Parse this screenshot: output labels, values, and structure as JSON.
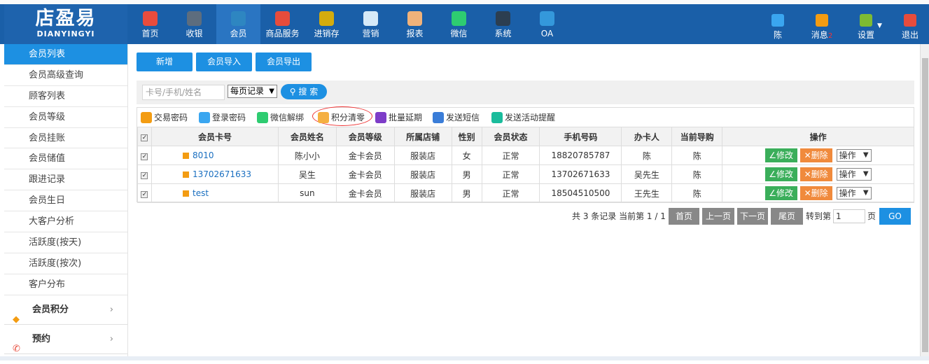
{
  "logo": {
    "cn": "店盈易",
    "en": "DIANYINGYI"
  },
  "nav": [
    {
      "label": "首页",
      "icon": "home-icon",
      "color": "#e84c3d"
    },
    {
      "label": "收银",
      "icon": "cashier-icon",
      "color": "#5d6d7e"
    },
    {
      "label": "会员",
      "icon": "member-icon",
      "color": "#2e86c1"
    },
    {
      "label": "商品服务",
      "icon": "goods-icon",
      "color": "#e74c3c"
    },
    {
      "label": "进销存",
      "icon": "inventory-icon",
      "color": "#d4ac0d"
    },
    {
      "label": "营销",
      "icon": "megaphone-icon",
      "color": "#d6eaf8"
    },
    {
      "label": "报表",
      "icon": "report-icon",
      "color": "#f0b27a"
    },
    {
      "label": "微信",
      "icon": "wechat-icon",
      "color": "#2ecc71"
    },
    {
      "label": "系统",
      "icon": "monitor-icon",
      "color": "#2c3e50"
    },
    {
      "label": "OA",
      "icon": "oa-icon",
      "color": "#3498db"
    }
  ],
  "right_nav": {
    "user": {
      "label": "陈",
      "icon": "user-icon",
      "color": "#3aa6f0"
    },
    "message": {
      "label": "消息",
      "badge": "2",
      "icon": "bell-icon",
      "color": "#f39c12"
    },
    "settings": {
      "label": "设置",
      "icon": "gear-icon",
      "color": "#7dbb33"
    },
    "logout": {
      "label": "退出",
      "icon": "logout-icon",
      "color": "#e74c3c"
    }
  },
  "sidebar": {
    "items": [
      "会员列表",
      "会员高级查询",
      "顾客列表",
      "会员等级",
      "会员挂账",
      "会员储值",
      "跟进记录",
      "会员生日",
      "大客户分析",
      "活跃度(按天)",
      "活跃度(按次)",
      "客户分布"
    ],
    "groups": [
      {
        "label": "会员积分"
      },
      {
        "label": "预约"
      }
    ]
  },
  "actions": {
    "add": "新增",
    "import": "会员导入",
    "export": "会员导出"
  },
  "search": {
    "placeholder": "卡号/手机/姓名",
    "page_size": "每页记录",
    "button": "搜 索"
  },
  "tools": [
    {
      "label": "交易密码",
      "icon": "key-icon",
      "color": "#f39c12"
    },
    {
      "label": "登录密码",
      "icon": "lock-icon",
      "color": "#3aa6f0"
    },
    {
      "label": "微信解绑",
      "icon": "link-icon",
      "color": "#2ecc71"
    },
    {
      "label": "积分清零",
      "icon": "medal-icon",
      "color": "#f5b041"
    },
    {
      "label": "批量延期",
      "icon": "clock-icon",
      "color": "#7d3cc8"
    },
    {
      "label": "发送短信",
      "icon": "mail-icon",
      "color": "#3a7dd8"
    },
    {
      "label": "发送活动提醒",
      "icon": "alarm-icon",
      "color": "#1abc9c"
    }
  ],
  "table": {
    "headers": [
      "会员卡号",
      "会员姓名",
      "会员等级",
      "所属店铺",
      "性别",
      "会员状态",
      "手机号码",
      "办卡人",
      "当前导购",
      "操作"
    ],
    "rows": [
      {
        "card": "8010",
        "name": "陈小小",
        "level": "金卡会员",
        "store": "服装店",
        "gender": "女",
        "status": "正常",
        "phone": "18820785787",
        "issuer": "陈",
        "guide": "陈"
      },
      {
        "card": "13702671633",
        "name": "吴生",
        "level": "金卡会员",
        "store": "服装店",
        "gender": "男",
        "status": "正常",
        "phone": "13702671633",
        "issuer": "吴先生",
        "guide": "陈"
      },
      {
        "card": "test",
        "name": "sun",
        "level": "金卡会员",
        "store": "服装店",
        "gender": "男",
        "status": "正常",
        "phone": "18504510500",
        "issuer": "王先生",
        "guide": "陈"
      }
    ],
    "edit_label": "修改",
    "delete_label": "删除",
    "op_label": "操作"
  },
  "pager": {
    "summary": "共 3 条记录 当前第 1 / 1",
    "first": "首页",
    "prev": "上一页",
    "next": "下一页",
    "last": "尾页",
    "goto": "转到第",
    "page_value": "1",
    "page_unit": "页",
    "go": "GO"
  }
}
